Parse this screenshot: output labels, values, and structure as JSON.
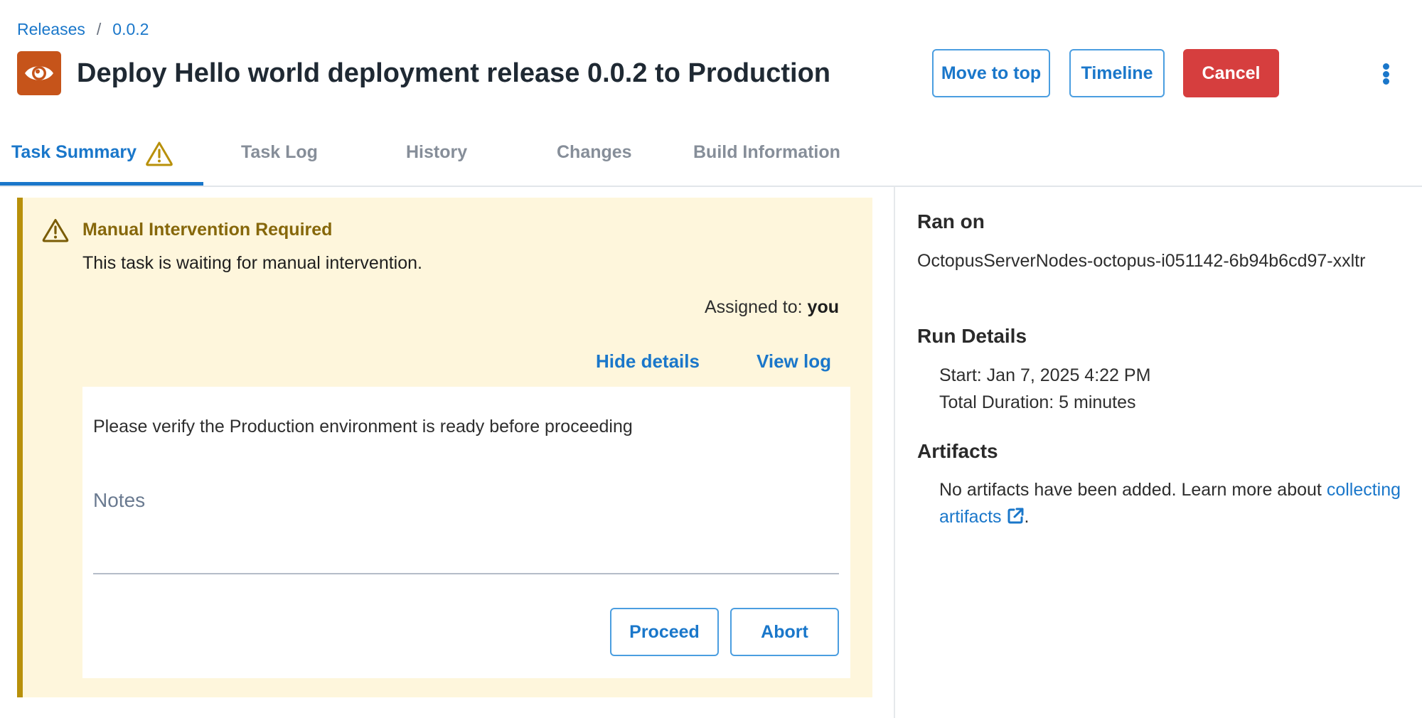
{
  "breadcrumb": {
    "items": [
      "Releases",
      "0.0.2"
    ],
    "separator": "/"
  },
  "header": {
    "icon": "eye-icon",
    "icon_color": "#c6541a",
    "title": "Deploy Hello world deployment release 0.0.2 to Production",
    "buttons": {
      "move_to_top": "Move to top",
      "timeline": "Timeline",
      "cancel": "Cancel"
    },
    "more_menu_icon": "kebab-menu-icon"
  },
  "tabs": [
    {
      "label": "Task Summary",
      "active": true,
      "icon": "warning-icon"
    },
    {
      "label": "Task Log",
      "active": false
    },
    {
      "label": "History",
      "active": false
    },
    {
      "label": "Changes",
      "active": false
    },
    {
      "label": "Build Information",
      "active": false
    }
  ],
  "intervention": {
    "icon": "warning-icon",
    "title": "Manual Intervention Required",
    "message": "This task is waiting for manual intervention.",
    "assigned_label": "Assigned to:",
    "assigned_to": "you",
    "hide_details": "Hide details",
    "view_log": "View log",
    "instructions": "Please verify the Production environment is ready before proceeding",
    "notes_label": "Notes",
    "notes_value": "",
    "proceed": "Proceed",
    "abort": "Abort"
  },
  "details": {
    "ran_on_heading": "Ran on",
    "ran_on_value": "OctopusServerNodes-octopus-i051142-6b94b6cd97-xxltr",
    "run_details_heading": "Run Details",
    "start": "Start: Jan 7, 2025 4:22 PM",
    "total_duration": "Total Duration: 5 minutes",
    "artifacts_heading": "Artifacts",
    "artifacts_text": "No artifacts have been added. Learn more about ",
    "artifacts_link": "collecting artifacts",
    "artifacts_suffix": "."
  },
  "colors": {
    "accent": "#1a77ca",
    "danger": "#d63e3e",
    "warning_border": "#b8900a",
    "warning_bg": "#fef6dc",
    "warning_text": "#86670a"
  }
}
